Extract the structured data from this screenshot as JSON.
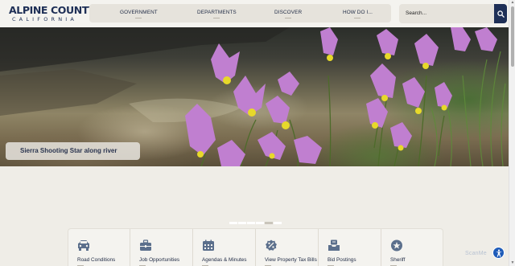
{
  "site": {
    "logo_main": "ALPINE COUNTY",
    "logo_sub": "CALIFORNIA"
  },
  "nav": {
    "items": [
      {
        "label": "GOVERNMENT"
      },
      {
        "label": "DEPARTMENTS"
      },
      {
        "label": "DISCOVER"
      },
      {
        "label": "HOW DO I..."
      }
    ]
  },
  "search": {
    "placeholder": "Search..."
  },
  "hero": {
    "caption": "Sierra Shooting Star along river",
    "slide_count": 6,
    "active_slide": 5
  },
  "quick_links": [
    {
      "label": "Road Conditions",
      "icon": "car-icon"
    },
    {
      "label": "Job Opportunities",
      "icon": "briefcase-icon"
    },
    {
      "label": "Agendas & Minutes",
      "icon": "calendar-icon"
    },
    {
      "label": "View Property Tax Bills",
      "icon": "percent-badge-icon"
    },
    {
      "label": "Bid Postings",
      "icon": "tray-icon"
    },
    {
      "label": "Sheriff",
      "icon": "star-badge-icon"
    }
  ],
  "watermark": "ScanMe",
  "colors": {
    "brand": "#1e2f56",
    "header_bg": "#f4f3ef",
    "page_bg": "#efede7",
    "accessibility": "#1e5bb8"
  }
}
